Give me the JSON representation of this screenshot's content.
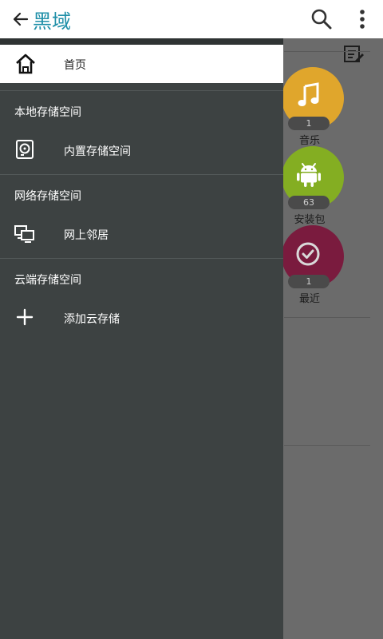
{
  "appbar": {
    "title": "黑域",
    "back_icon": "back-arrow-icon",
    "search_icon": "search-icon",
    "more_icon": "overflow-menu-icon",
    "title_color": "#1f8fa8"
  },
  "drawer": {
    "home": {
      "label": "首页",
      "icon": "home-icon"
    },
    "sections": [
      {
        "header": "本地存储空间",
        "items": [
          {
            "label": "内置存储空间",
            "icon": "storage-icon"
          }
        ]
      },
      {
        "header": "网络存储空间",
        "items": [
          {
            "label": "网上邻居",
            "icon": "network-icon"
          }
        ]
      },
      {
        "header": "云端存储空间",
        "items": [
          {
            "label": "添加云存储",
            "icon": "plus-icon"
          }
        ]
      }
    ],
    "background_color": "#3d4242"
  },
  "background": {
    "categories": [
      {
        "label": "音乐",
        "count": "1",
        "color": "#e0a62c",
        "icon": "music-note-icon"
      },
      {
        "label": "安装包",
        "count": "63",
        "color": "#84ae22",
        "icon": "android-icon"
      },
      {
        "label": "最近",
        "count": "1",
        "color": "#7a1b3e",
        "icon": "recent-check-icon"
      }
    ],
    "edit_icon": "edit-list-icon"
  }
}
